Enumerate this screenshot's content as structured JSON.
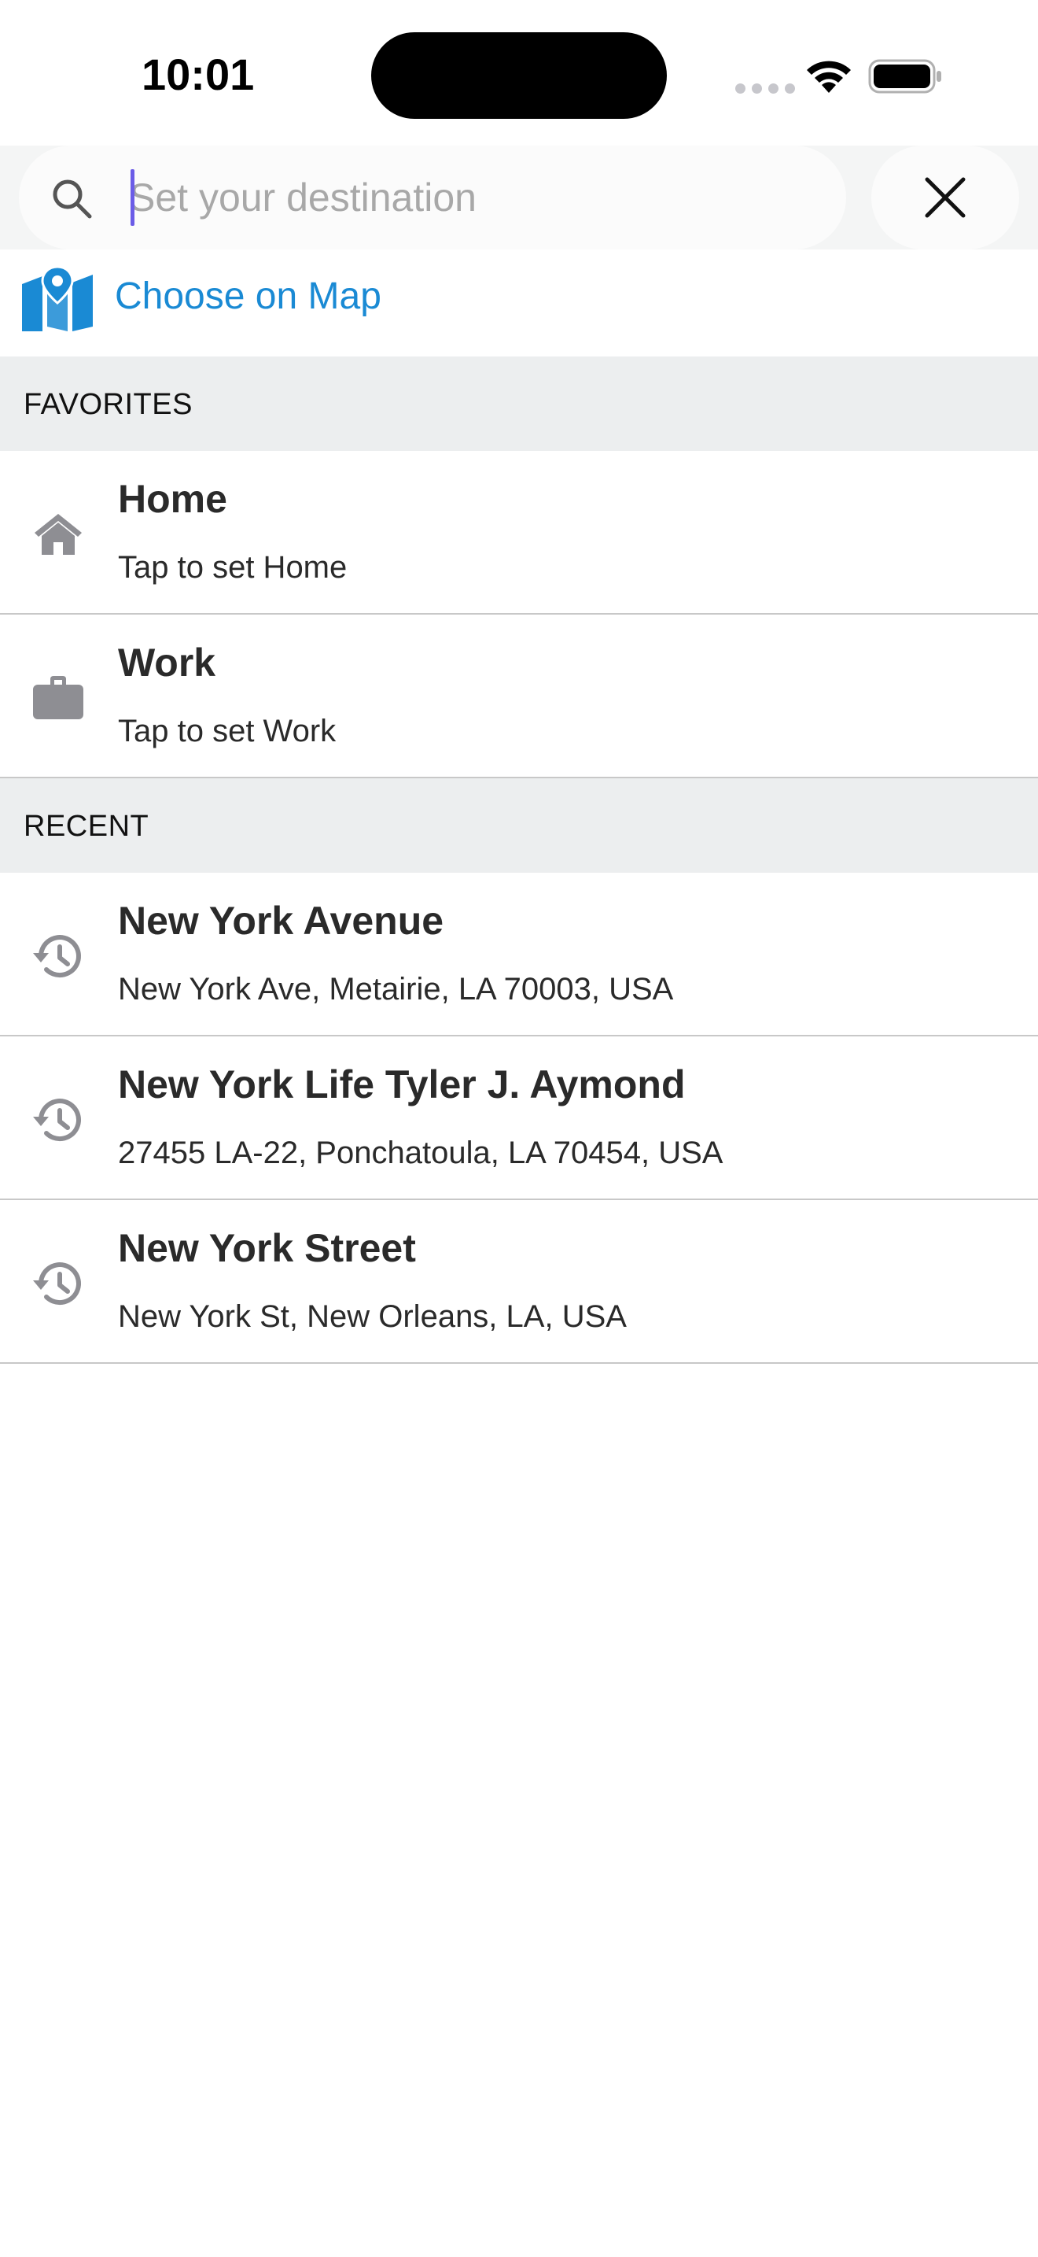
{
  "status_bar": {
    "time": "10:01"
  },
  "search": {
    "placeholder": "Set your destination",
    "value": ""
  },
  "choose_on_map": {
    "label": "Choose on Map"
  },
  "favorites": {
    "header": "FAVORITES",
    "items": [
      {
        "title": "Home",
        "subtitle": "Tap to set Home",
        "icon": "home-icon"
      },
      {
        "title": "Work",
        "subtitle": "Tap to set Work",
        "icon": "briefcase-icon"
      }
    ]
  },
  "recent": {
    "header": "RECENT",
    "items": [
      {
        "title": "New York Avenue",
        "subtitle": "New York Ave, Metairie, LA 70003, USA",
        "icon": "history-icon"
      },
      {
        "title": "New York Life Tyler J. Aymond",
        "subtitle": "27455 LA-22, Ponchatoula, LA 70454, USA",
        "icon": "history-icon"
      },
      {
        "title": "New York Street",
        "subtitle": "New York St, New Orleans, LA, USA",
        "icon": "history-icon"
      }
    ]
  },
  "colors": {
    "accent": "#1a8ad4",
    "caret": "#6b5ce7",
    "section_background": "#eceeef",
    "icon_gray": "#8e8e93"
  }
}
